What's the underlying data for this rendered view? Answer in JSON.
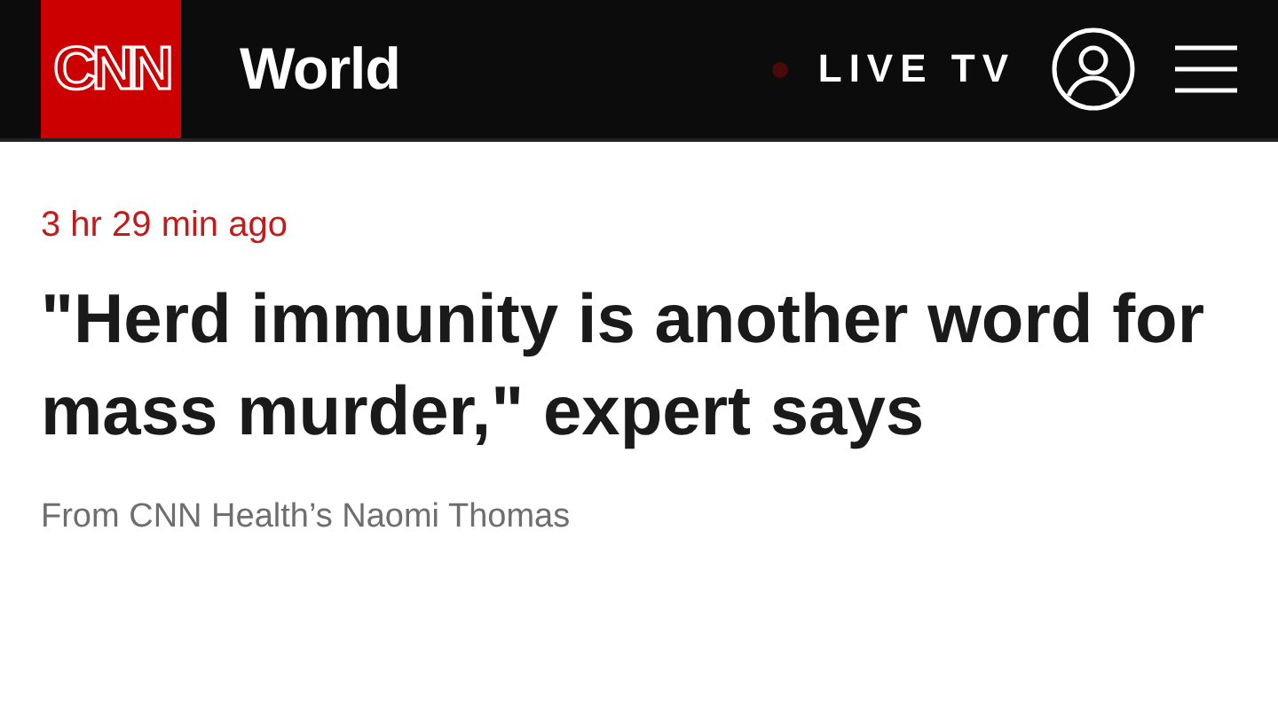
{
  "header": {
    "logo": "CNN",
    "section": "World",
    "live_tv": "LIVE TV"
  },
  "article": {
    "timestamp": "3 hr 29 min ago",
    "headline": "\"Herd immunity is another word for mass murder,\" expert says",
    "byline": "From CNN Health’s Naomi Thomas"
  }
}
